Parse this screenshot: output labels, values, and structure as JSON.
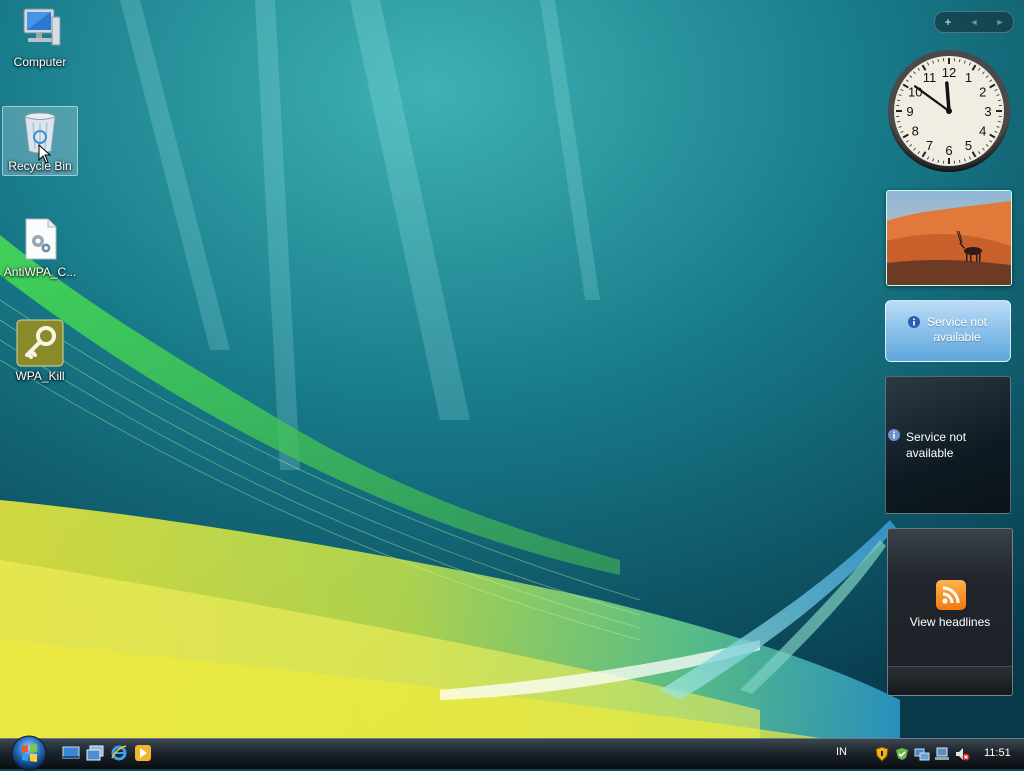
{
  "desktop": {
    "icons": [
      {
        "label": "Computer",
        "icon": "computer-icon"
      },
      {
        "label": "Recycle Bin",
        "icon": "recycle-bin-icon",
        "selected": true
      },
      {
        "label": "AntiWPA_C...",
        "icon": "settings-file-icon"
      },
      {
        "label": "WPA_Kill",
        "icon": "key-icon"
      }
    ]
  },
  "sidebar": {
    "controls": {
      "add": "+",
      "prev": "◄",
      "next": "►"
    },
    "clock": {
      "hour": 11,
      "minute": 51,
      "second": 0,
      "numerals": [
        "12",
        "1",
        "2",
        "3",
        "4",
        "5",
        "6",
        "7",
        "8",
        "9",
        "10",
        "11"
      ]
    },
    "slideshow": {
      "image": "desert-oryx"
    },
    "weather": {
      "message": "Service not available"
    },
    "stocks": {
      "message": "Service not available"
    },
    "feed": {
      "label": "View headlines"
    }
  },
  "taskbar": {
    "start": "start-orb",
    "quick_launch": [
      "show-desktop-icon",
      "switch-windows-icon",
      "internet-explorer-icon",
      "media-player-icon"
    ],
    "language": "IN",
    "tray": [
      "security-shield-icon",
      "defender-icon",
      "network-icon",
      "network-connection-icon",
      "volume-muted-icon"
    ],
    "time": "11:51"
  },
  "colors": {
    "accent": "#1e7a86",
    "taskbar": "#1c252c"
  }
}
